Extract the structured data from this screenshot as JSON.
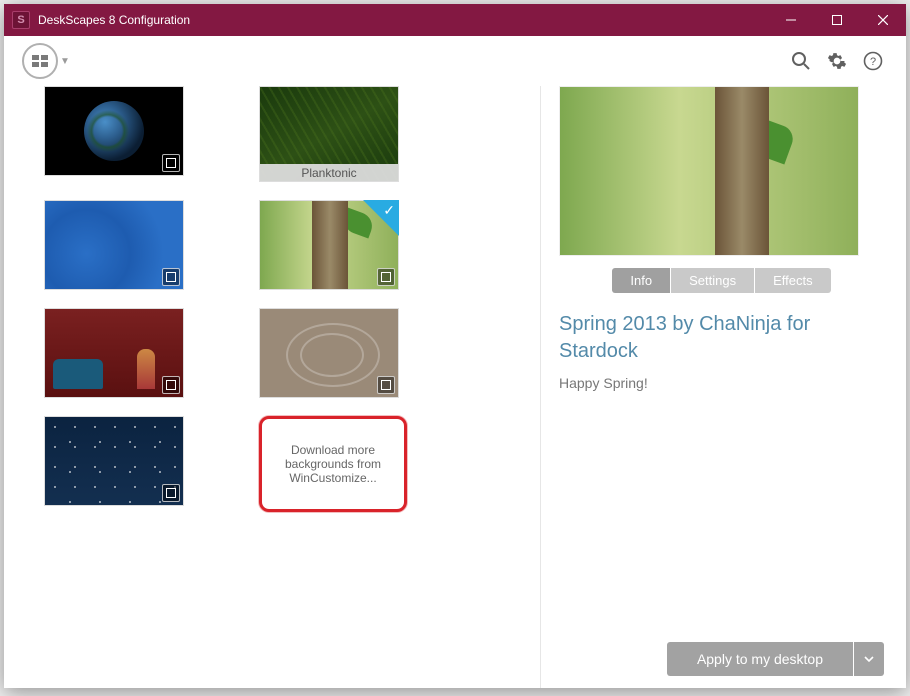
{
  "titlebar": {
    "app_letter": "S",
    "title": "DeskScapes 8 Configuration"
  },
  "gallery": {
    "items": [
      {
        "caption": null
      },
      {
        "caption": "Planktonic"
      },
      {
        "caption": null
      },
      {
        "caption": null,
        "selected": true
      },
      {
        "caption": null
      },
      {
        "caption": null
      },
      {
        "caption": null
      }
    ],
    "download_label": "Download more backgrounds from WinCustomize..."
  },
  "tabs": {
    "info": "Info",
    "settings": "Settings",
    "effects": "Effects"
  },
  "detail": {
    "title": "Spring 2013 by ChaNinja for Stardock",
    "description": "Happy Spring!"
  },
  "apply": {
    "label": "Apply to my desktop"
  }
}
